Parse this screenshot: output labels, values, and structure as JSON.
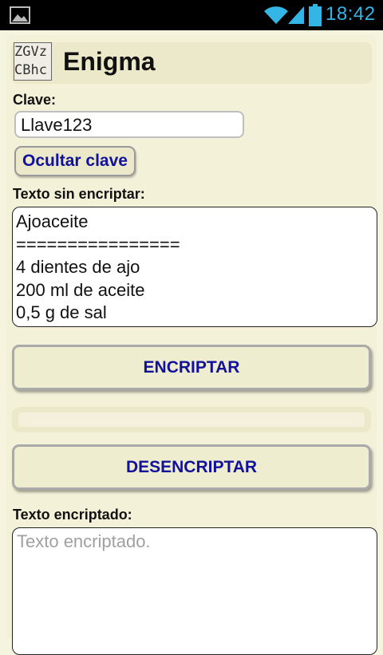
{
  "status_bar": {
    "time": "18:42",
    "icons": [
      "image-icon",
      "wifi-icon",
      "signal-icon",
      "battery-icon"
    ],
    "accent": "#33b5e5"
  },
  "app": {
    "title": "Enigma",
    "icon_text": "ZGVz\nCBhc"
  },
  "key": {
    "label": "Clave:",
    "value": "Llave123"
  },
  "hide_key_button": "Ocultar clave",
  "plain_text": {
    "label": "Texto sin encriptar:",
    "value": "Ajoaceite\n================\n4 dientes de ajo\n200 ml de aceite\n0,5 g de sal"
  },
  "encrypt_button": "ENCRIPTAR",
  "progress": {
    "value": 0
  },
  "decrypt_button": "DESENCRIPTAR",
  "encrypted_text": {
    "label": "Texto encriptado:",
    "placeholder": "Texto encriptado.",
    "value": ""
  },
  "colors": {
    "background": "#f5f4df",
    "panel": "#ebe9c9",
    "button_text": "#11119c"
  }
}
